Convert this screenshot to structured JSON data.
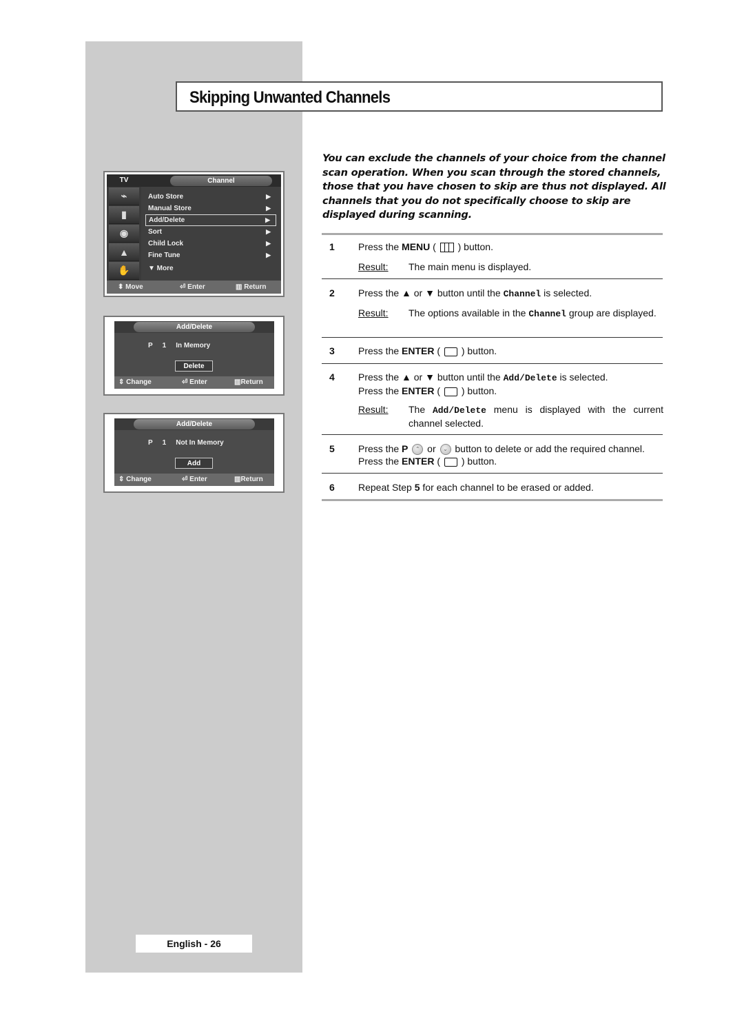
{
  "page": {
    "title": "Skipping Unwanted Channels",
    "footer": "English - 26",
    "colors": {
      "sidebar": "#cccccc",
      "osd_bg": "#4a4a4a",
      "osd_footer": "#6a6a6a",
      "rule": "#aaaaaa"
    }
  },
  "channel_menu": {
    "tv_label": "TV",
    "header": "Channel",
    "icons": [
      "antenna-icon",
      "picture-icon",
      "sound-icon",
      "channel-icon",
      "setup-icon"
    ],
    "items": [
      {
        "label": "Auto Store",
        "arrow": "▶"
      },
      {
        "label": "Manual Store",
        "arrow": "▶"
      },
      {
        "label": "Add/Delete",
        "arrow": "▶",
        "selected": true
      },
      {
        "label": "Sort",
        "arrow": "▶"
      },
      {
        "label": "Child Lock",
        "arrow": "▶"
      },
      {
        "label": "Fine Tune",
        "arrow": "▶"
      },
      {
        "label": "▼ More",
        "arrow": ""
      }
    ],
    "footer": {
      "move": "Move",
      "enter": "Enter",
      "return": "Return"
    }
  },
  "add_delete_screens": [
    {
      "header": "Add/Delete",
      "prefix": "P",
      "channel": "1",
      "status": "In Memory",
      "button": "Delete",
      "footer": {
        "change": "Change",
        "enter": "Enter",
        "return": "Return"
      }
    },
    {
      "header": "Add/Delete",
      "prefix": "P",
      "channel": "1",
      "status": "Not In Memory",
      "button": "Add",
      "footer": {
        "change": "Change",
        "enter": "Enter",
        "return": "Return"
      }
    }
  ],
  "intro": "You can exclude the channels of your choice from the channel scan operation. When you scan through the stored channels, those that you have chosen to skip are thus not displayed. All channels that you do not specifically choose to skip are displayed during scanning.",
  "steps": {
    "s1": {
      "num": "1",
      "a": "Press the ",
      "b": "MENU",
      "c": " ( ",
      "d": " ) button.",
      "result_label": "Result:",
      "result": "The main menu is displayed."
    },
    "s2": {
      "num": "2",
      "a": "Press the ▲ or ▼ button until the ",
      "b": "Channel",
      "c": " is selected.",
      "result_label": "Result:",
      "r1": "The options available in the ",
      "r2": "Channel",
      "r3": " group are displayed."
    },
    "s3": {
      "num": "3",
      "a": "Press the ",
      "b": "ENTER",
      "c": " ( ",
      "d": " ) button."
    },
    "s4": {
      "num": "4",
      "a": "Press the ▲ or ▼ button until the ",
      "b": "Add/Delete",
      "c": " is selected.",
      "d": "Press the ",
      "e": "ENTER",
      "f": " ( ",
      "g": " ) button.",
      "result_label": "Result:",
      "r1": "The ",
      "r2": "Add/Delete",
      "r3": " menu is displayed with the current channel selected."
    },
    "s5": {
      "num": "5",
      "a": "Press the ",
      "b": "P",
      "c": " or ",
      "d": " button to delete or add the required channel. Press the ",
      "e": "ENTER",
      "f": " ( ",
      "g": " ) button."
    },
    "s6": {
      "num": "6",
      "a": "Repeat Step ",
      "b": "5",
      "c": " for each channel to be erased or added."
    }
  }
}
